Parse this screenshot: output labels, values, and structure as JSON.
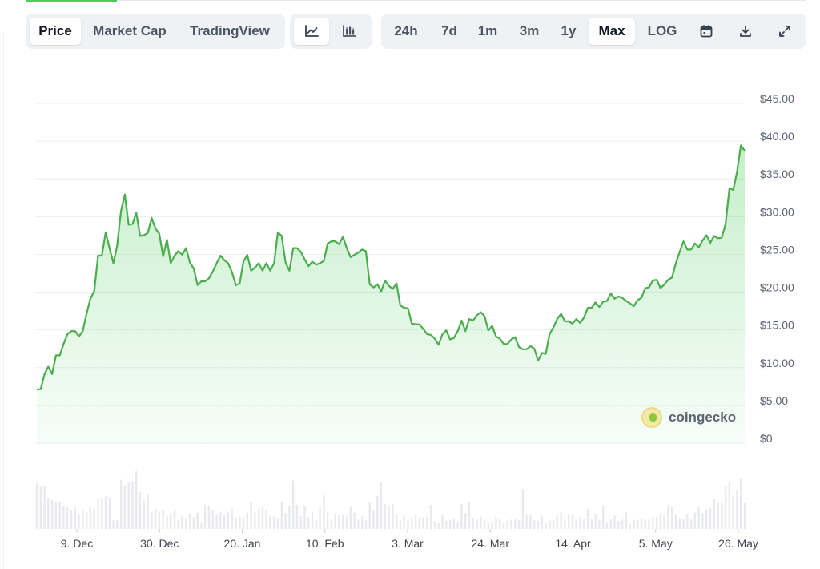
{
  "tabs": {
    "items": [
      {
        "label": "Price",
        "active": true
      },
      {
        "label": "Market Cap",
        "active": false
      },
      {
        "label": "TradingView",
        "active": false
      }
    ]
  },
  "chart_types": {
    "items": [
      {
        "icon": "line-chart-icon",
        "active": true
      },
      {
        "icon": "candlestick-chart-icon",
        "active": false
      }
    ]
  },
  "ranges": {
    "items": [
      {
        "label": "24h",
        "active": false
      },
      {
        "label": "7d",
        "active": false
      },
      {
        "label": "1m",
        "active": false
      },
      {
        "label": "3m",
        "active": false
      },
      {
        "label": "1y",
        "active": false
      },
      {
        "label": "Max",
        "active": true
      },
      {
        "label": "LOG",
        "active": false
      }
    ],
    "icons": [
      "calendar-icon",
      "download-icon",
      "expand-icon"
    ]
  },
  "brand": {
    "name": "coingecko"
  },
  "colors": {
    "line": "#4bad4d",
    "area": "#4bcc5b",
    "volume": "#e8eaed",
    "grid": "#eceef1"
  },
  "chart_data": {
    "type": "area",
    "title": "",
    "xlabel": "",
    "ylabel": "",
    "ylim": [
      0,
      45
    ],
    "yticks": [
      "$0",
      "$5.00",
      "$10.00",
      "$15.00",
      "$20.00",
      "$25.00",
      "$30.00",
      "$35.00",
      "$40.00",
      "$45.00"
    ],
    "xticks": [
      "9. Dec",
      "30. Dec",
      "20. Jan",
      "10. Feb",
      "3. Mar",
      "24. Mar",
      "14. Apr",
      "5. May",
      "26. May"
    ],
    "grid": true,
    "legend": "none",
    "series": [
      {
        "values": [
          6.5,
          6.5,
          8.5,
          9.5,
          8.5,
          11,
          11,
          12.5,
          13.8,
          14.2,
          14.2,
          13.5,
          14.2,
          16.5,
          18.5,
          19.5,
          24.2,
          24.2,
          27.3,
          25.2,
          23.2,
          25.5,
          30.1,
          32.3,
          28.3,
          28.4,
          29.9,
          26.8,
          26.9,
          27.2,
          29.2,
          27.8,
          27.1,
          24.1,
          26.3,
          23.2,
          24.2,
          24.8,
          24.3,
          25.2,
          23.3,
          22.5,
          20.3,
          20.8,
          20.8,
          21.2,
          22.1,
          23.2,
          24.2,
          23.6,
          23.2,
          22.0,
          20.3,
          20.5,
          23.4,
          24.3,
          22.2,
          22.6,
          23.2,
          22.2,
          23.2,
          22.2,
          23.2,
          27.3,
          26.8,
          23.3,
          22.2,
          25.2,
          25.2,
          24.7,
          23.7,
          22.8,
          23.4,
          23.0,
          23.2,
          23.5,
          25.8,
          26.1,
          26.1,
          25.7,
          26.7,
          25.2,
          24.0,
          24.3,
          24.6,
          25.0,
          24.8,
          20.4,
          20.0,
          20.4,
          19.5,
          20.9,
          20.2,
          19.8,
          20.5,
          17.6,
          17.3,
          17.2,
          15.2,
          15.1,
          15.1,
          14.5,
          13.8,
          13.7,
          13.2,
          12.4,
          13.8,
          14.3,
          13.1,
          13.3,
          14.2,
          15.6,
          14.2,
          15.8,
          15.6,
          16.3,
          16.7,
          16.2,
          14.3,
          14.9,
          13.5,
          13.2,
          12.5,
          12.5,
          13.1,
          13.4,
          12.1,
          11.8,
          11.8,
          12.2,
          11.9,
          10.3,
          11.3,
          11.2,
          13.8,
          14.7,
          15.8,
          16.5,
          15.5,
          15.5,
          15.2,
          15.8,
          15.3,
          16.0,
          17.3,
          17.3,
          18.0,
          17.4,
          18.1,
          18.2,
          19.2,
          18.5,
          18.8,
          18.6,
          18.2,
          17.9,
          17.5,
          18.3,
          18.6,
          19.9,
          20.0,
          20.9,
          21.0,
          19.9,
          20.4,
          21.0,
          21.3,
          23.2,
          24.7,
          26.1,
          25.0,
          25.0,
          25.8,
          25.3,
          26.2,
          26.9,
          25.9,
          26.8,
          26.5,
          26.6,
          28.4,
          33.1,
          32.9,
          35.3,
          38.8,
          38.1
        ]
      }
    ],
    "volume": [
      58,
      54,
      55,
      40,
      37,
      35,
      34,
      30,
      27,
      24,
      27,
      19,
      23,
      21,
      28,
      26,
      38,
      40,
      42,
      40,
      11,
      11,
      63,
      56,
      59,
      61,
      74,
      47,
      37,
      44,
      22,
      26,
      22,
      24,
      17,
      19,
      25,
      11,
      16,
      14,
      20,
      15,
      21,
      7,
      31,
      30,
      24,
      18,
      22,
      17,
      21,
      26,
      15,
      16,
      15,
      21,
      34,
      21,
      27,
      28,
      24,
      17,
      16,
      14,
      34,
      20,
      29,
      62,
      31,
      16,
      30,
      15,
      21,
      11,
      28,
      43,
      21,
      12,
      20,
      18,
      18,
      16,
      28,
      21,
      12,
      16,
      11,
      34,
      24,
      42,
      59,
      32,
      30,
      32,
      19,
      11,
      17,
      11,
      15,
      18,
      15,
      15,
      15,
      31,
      10,
      8,
      19,
      10,
      11,
      14,
      9,
      32,
      20,
      35,
      14,
      12,
      16,
      12,
      8,
      10,
      15,
      12,
      8,
      10,
      12,
      13,
      11,
      51,
      19,
      19,
      11,
      10,
      17,
      8,
      11,
      11,
      17,
      21,
      12,
      18,
      19,
      14,
      15,
      12,
      26,
      13,
      20,
      11,
      29,
      8,
      12,
      18,
      10,
      12,
      21,
      6,
      12,
      11,
      14,
      12,
      12,
      15,
      15,
      20,
      17,
      31,
      28,
      19,
      14,
      12,
      19,
      13,
      21,
      28,
      20,
      25,
      27,
      38,
      33,
      33,
      56,
      60,
      42,
      50,
      64,
      33
    ]
  }
}
